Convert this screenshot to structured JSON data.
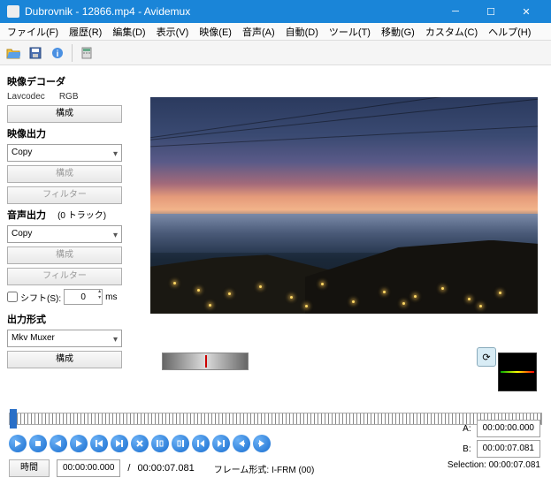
{
  "window": {
    "title": "Dubrovnik - 12866.mp4 - Avidemux"
  },
  "menu": [
    "ファイル(F)",
    "履歴(R)",
    "編集(D)",
    "表示(V)",
    "映像(E)",
    "音声(A)",
    "自動(D)",
    "ツール(T)",
    "移動(G)",
    "カスタム(C)",
    "ヘルプ(H)"
  ],
  "left": {
    "decoder_label": "映像デコーダ",
    "decoder_codec": "Lavcodec",
    "decoder_fmt": "RGB",
    "configure": "構成",
    "vout_label": "映像出力",
    "vout_mode": "Copy",
    "filter": "フィルター",
    "aout_label": "音声出力",
    "aout_tracks": "(0 トラック)",
    "aout_mode": "Copy",
    "shift_label": "シフト(S):",
    "shift_value": "0",
    "shift_unit": "ms",
    "format_label": "出力形式",
    "format_value": "Mkv Muxer"
  },
  "bottom": {
    "time_btn": "時間",
    "time_current": "00:00:00.000",
    "time_total": "00:00:07.081",
    "frame_label": "フレーム形式: I-FRM (00)",
    "a_label": "A:",
    "b_label": "B:",
    "a_time": "00:00:00.000",
    "b_time": "00:00:07.081",
    "selection_label": "Selection: 00:00:07.081"
  }
}
